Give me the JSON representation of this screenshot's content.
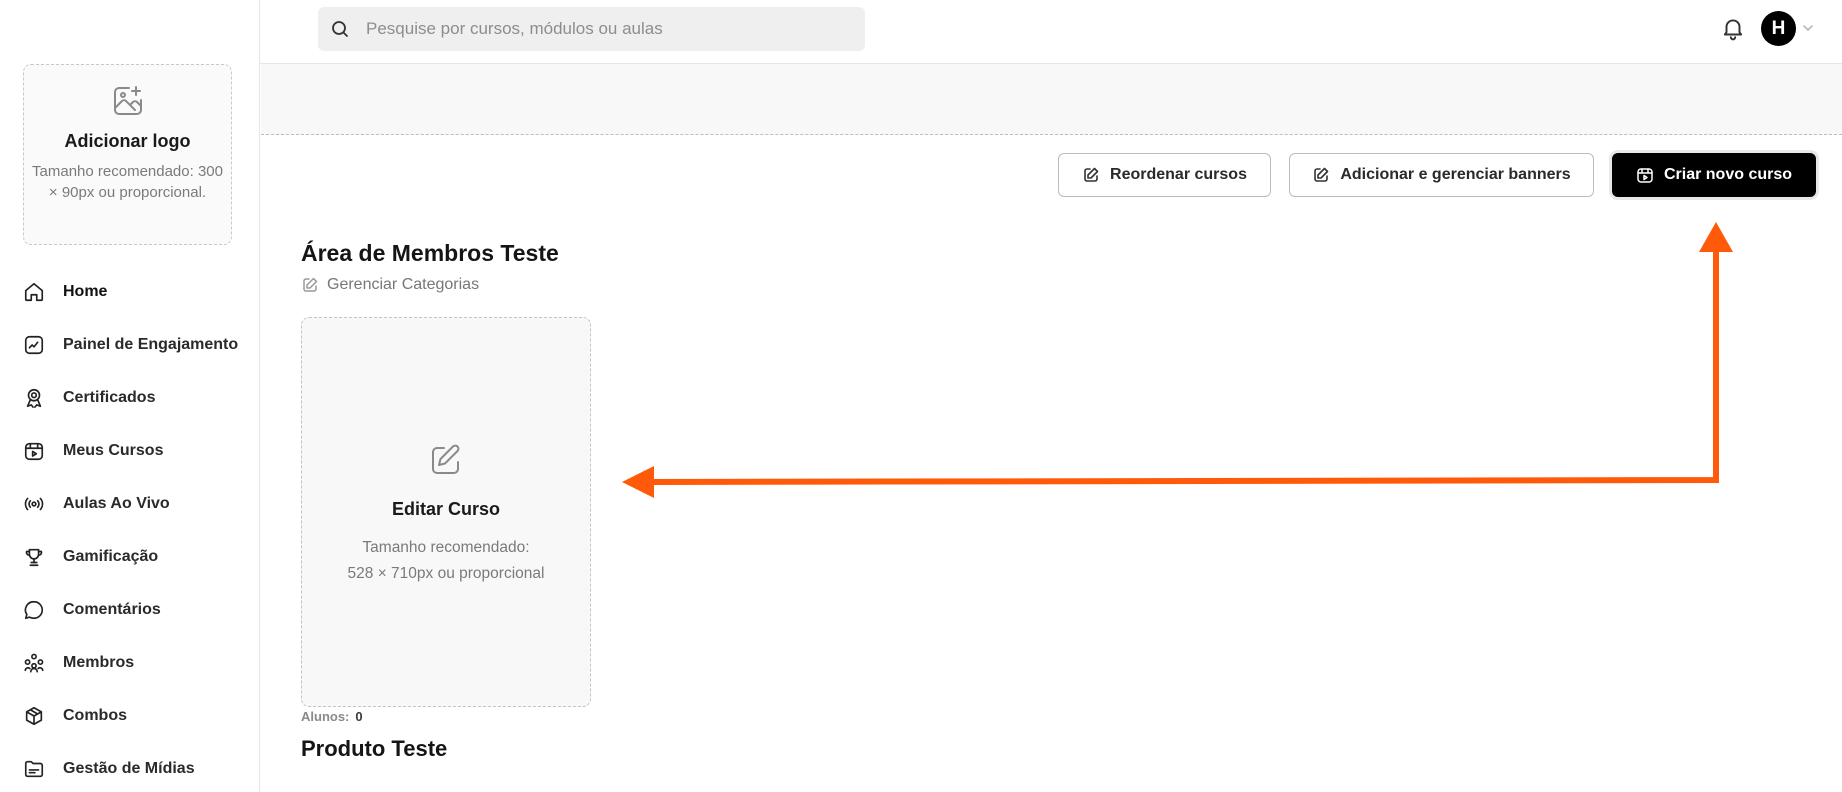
{
  "search": {
    "placeholder": "Pesquise por cursos, módulos ou aulas"
  },
  "user": {
    "avatar_initial": "H"
  },
  "logo_upload": {
    "title": "Adicionar logo",
    "subtitle": "Tamanho recomendado: 300 × 90px ou proporcional."
  },
  "sidebar": {
    "items": [
      {
        "label": "Home",
        "icon": "home-icon"
      },
      {
        "label": "Painel de Engajamento",
        "icon": "trending-chart-icon"
      },
      {
        "label": "Certificados",
        "icon": "award-badge-icon"
      },
      {
        "label": "Meus Cursos",
        "icon": "course-play-icon"
      },
      {
        "label": "Aulas Ao Vivo",
        "icon": "live-broadcast-icon"
      },
      {
        "label": "Gamificação",
        "icon": "trophy-icon"
      },
      {
        "label": "Comentários",
        "icon": "comment-bubble-icon"
      },
      {
        "label": "Membros",
        "icon": "members-icon"
      },
      {
        "label": "Combos",
        "icon": "box-icon"
      },
      {
        "label": "Gestão de Mídias",
        "icon": "media-folder-icon"
      }
    ]
  },
  "actions": {
    "reorder": "Reordenar cursos",
    "banners": "Adicionar e gerenciar banners",
    "new_course": "Criar novo curso"
  },
  "main": {
    "area_title": "Área de Membros Teste",
    "manage_categories": "Gerenciar Categorias",
    "card": {
      "title": "Editar Curso",
      "subtitle_line1": "Tamanho recomendado:",
      "subtitle_line2": "528 × 710px ou proporcional"
    },
    "students_label": "Alunos:",
    "students_count": "0",
    "product_title": "Produto Teste"
  },
  "colors": {
    "accent_arrow": "#ff5a0a",
    "primary_button": "#000000"
  }
}
